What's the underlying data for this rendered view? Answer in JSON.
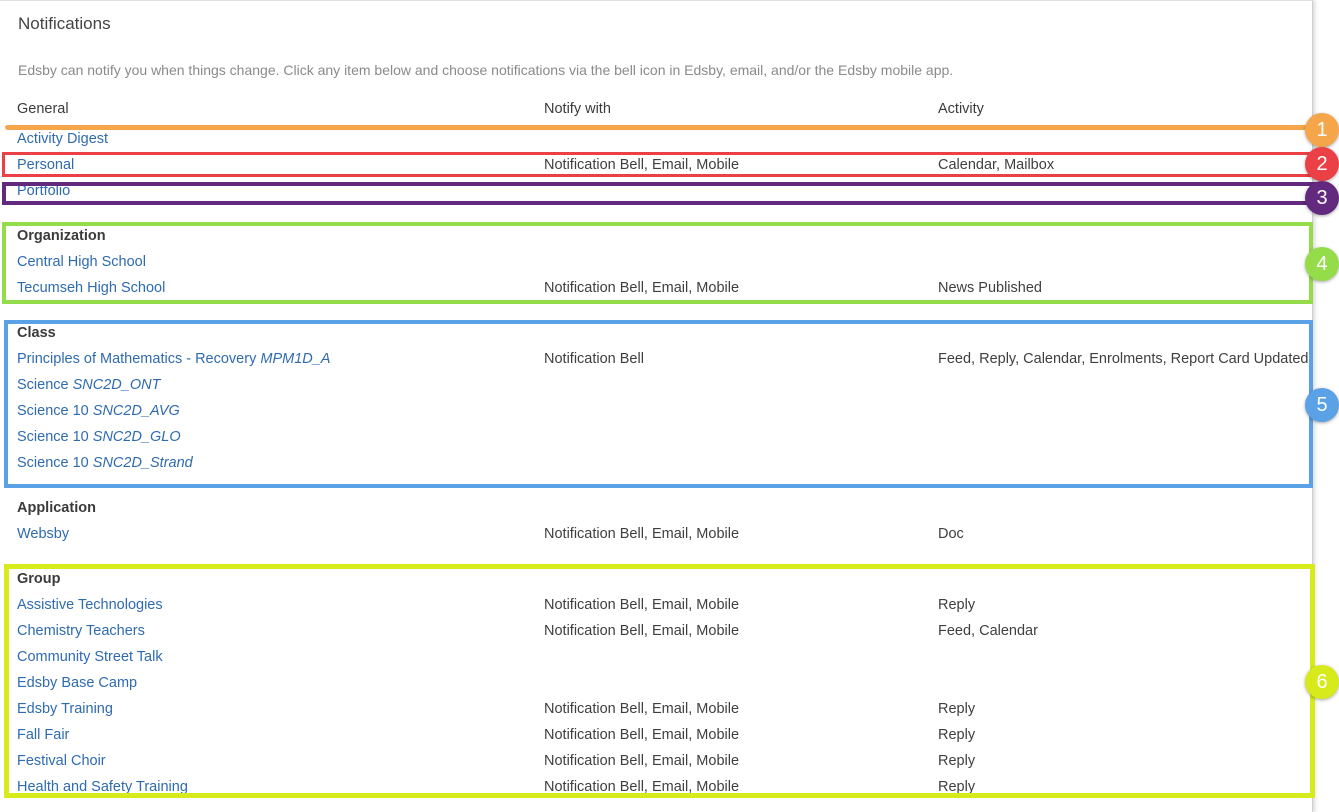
{
  "title": "Notifications",
  "description": "Edsby can notify you when things change. Click any item below and choose notifications via the bell icon in Edsby, email, and/or the Edsby mobile app.",
  "headers": {
    "general": "General",
    "notify_with": "Notify with",
    "activity": "Activity"
  },
  "general": [
    {
      "name": "Activity Digest",
      "notify": "",
      "activity": ""
    },
    {
      "name": "Personal",
      "notify": "Notification Bell, Email, Mobile",
      "activity": "Calendar, Mailbox"
    },
    {
      "name": "Portfolio",
      "notify": "",
      "activity": ""
    }
  ],
  "organization": {
    "label": "Organization",
    "items": [
      {
        "name": "Central High School",
        "notify": "",
        "activity": ""
      },
      {
        "name": "Tecumseh High School",
        "notify": "Notification Bell, Email, Mobile",
        "activity": "News Published"
      }
    ]
  },
  "class": {
    "label": "Class",
    "items": [
      {
        "name": "Principles of Mathematics - Recovery ",
        "code": "MPM1D_A",
        "notify": "Notification Bell",
        "activity": "Feed, Reply, Calendar, Enrolments, Report Card Updated"
      },
      {
        "name": "Science ",
        "code": "SNC2D_ONT",
        "notify": "",
        "activity": ""
      },
      {
        "name": "Science 10 ",
        "code": "SNC2D_AVG",
        "notify": "",
        "activity": ""
      },
      {
        "name": "Science 10 ",
        "code": "SNC2D_GLO",
        "notify": "",
        "activity": ""
      },
      {
        "name": "Science 10 ",
        "code": "SNC2D_Strand",
        "notify": "",
        "activity": ""
      }
    ]
  },
  "application": {
    "label": "Application",
    "items": [
      {
        "name": "Websby",
        "notify": "Notification Bell, Email, Mobile",
        "activity": "Doc"
      }
    ]
  },
  "group": {
    "label": "Group",
    "items": [
      {
        "name": "Assistive Technologies",
        "notify": "Notification Bell, Email, Mobile",
        "activity": "Reply"
      },
      {
        "name": "Chemistry Teachers",
        "notify": "Notification Bell, Email, Mobile",
        "activity": "Feed, Calendar"
      },
      {
        "name": "Community Street Talk",
        "notify": "",
        "activity": ""
      },
      {
        "name": "Edsby Base Camp",
        "notify": "",
        "activity": ""
      },
      {
        "name": "Edsby Training",
        "notify": "Notification Bell, Email, Mobile",
        "activity": "Reply"
      },
      {
        "name": "Fall Fair",
        "notify": "Notification Bell, Email, Mobile",
        "activity": "Reply"
      },
      {
        "name": "Festival Choir",
        "notify": "Notification Bell, Email, Mobile",
        "activity": "Reply"
      },
      {
        "name": "Health and Safety Training",
        "notify": "Notification Bell, Email, Mobile",
        "activity": "Reply"
      }
    ]
  },
  "callouts": [
    {
      "number": "1",
      "color": "#f5a64a"
    },
    {
      "number": "2",
      "color": "#ea4046"
    },
    {
      "number": "3",
      "color": "#62297f"
    },
    {
      "number": "4",
      "color": "#94dc4a"
    },
    {
      "number": "5",
      "color": "#5aa1e6"
    },
    {
      "number": "6",
      "color": "#d6ea1c"
    }
  ]
}
